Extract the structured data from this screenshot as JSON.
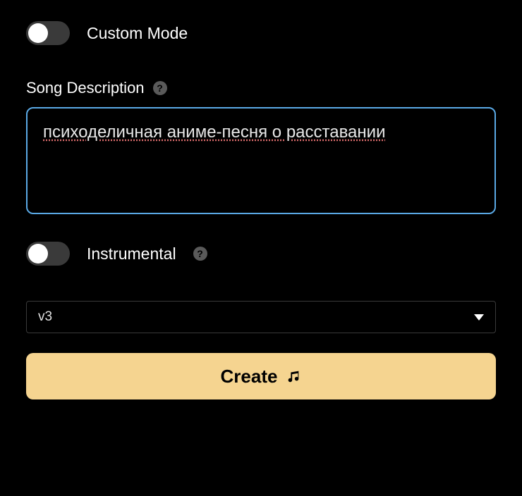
{
  "custom_mode": {
    "label": "Custom Mode",
    "enabled": false
  },
  "song_description": {
    "label": "Song Description",
    "value": "психоделичная аниме-песня о расставании"
  },
  "instrumental": {
    "label": "Instrumental",
    "enabled": false
  },
  "version_select": {
    "selected": "v3"
  },
  "create_button": {
    "label": "Create"
  }
}
